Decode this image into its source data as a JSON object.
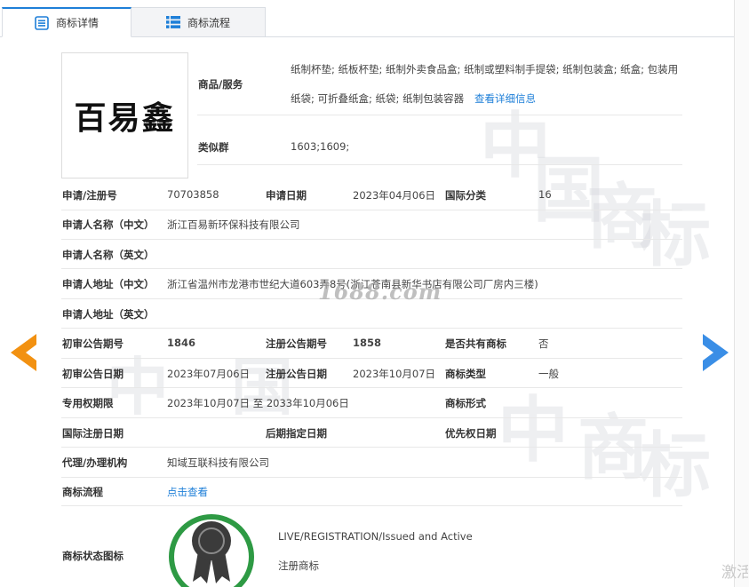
{
  "tabs": [
    {
      "label": "商标详情"
    },
    {
      "label": "商标流程"
    }
  ],
  "logo": {
    "text": "百易鑫"
  },
  "goods": {
    "label": "商品/服务",
    "line1": "纸制杯垫; 纸板杯垫; 纸制外卖食品盒; 纸制或塑料制手提袋; 纸制包装盒; 纸盒; 包装用",
    "line2": "纸袋; 可折叠纸盒; 纸袋; 纸制包装容器",
    "detail_link": "查看详细信息"
  },
  "similar_group": {
    "label": "类似群",
    "value": "1603;1609;"
  },
  "fields": {
    "reg_no_label": "申请/注册号",
    "reg_no": "70703858",
    "apply_date_label": "申请日期",
    "apply_date": "2023年04月06日",
    "intl_class_label": "国际分类",
    "intl_class": "16",
    "applicant_cn_label": "申请人名称（中文）",
    "applicant_cn": "浙江百易新环保科技有限公司",
    "applicant_en_label": "申请人名称（英文）",
    "applicant_en": "",
    "address_cn_label": "申请人地址（中文）",
    "address_cn": "浙江省温州市龙港市世纪大道603弄8号(浙江苍南县新华书店有限公司厂房内三楼)",
    "address_en_label": "申请人地址（英文）",
    "address_en": "",
    "prelim_no_label": "初审公告期号",
    "prelim_no": "1846",
    "reg_pub_no_label": "注册公告期号",
    "reg_pub_no": "1858",
    "shared_label": "是否共有商标",
    "shared": "否",
    "prelim_date_label": "初审公告日期",
    "prelim_date": "2023年07月06日",
    "reg_pub_date_label": "注册公告日期",
    "reg_pub_date": "2023年10月07日",
    "type_label": "商标类型",
    "type": "一般",
    "exclusive_label": "专用权期限",
    "exclusive": "2023年10月07日 至 2033年10月06日",
    "form_label": "商标形式",
    "form": "",
    "intl_reg_label": "国际注册日期",
    "intl_reg": "",
    "later_date_label": "后期指定日期",
    "later_date": "",
    "priority_label": "优先权日期",
    "priority": "",
    "agent_label": "代理/办理机构",
    "agent": "知域互联科技有限公司",
    "flow_label": "商标流程",
    "flow_link": "点击查看",
    "status_icon_label": "商标状态图标"
  },
  "status": {
    "line1": "LIVE/REGISTRATION/Issued and Active",
    "line2": "注册商标"
  },
  "watermark": {
    "site": "1688.com"
  },
  "corner": {
    "text": "激活"
  },
  "colors": {
    "accent": "#1e7fd8",
    "arrow_left": "#f29111",
    "arrow_right": "#3a8ee6",
    "badge_ring": "#2e9a44"
  }
}
